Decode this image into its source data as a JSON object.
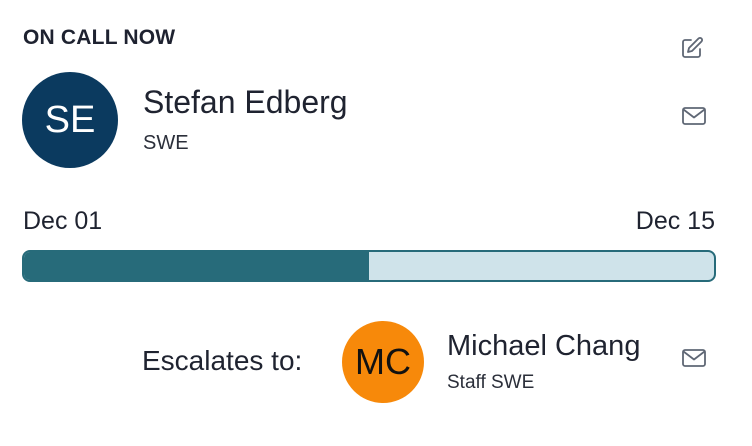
{
  "header": {
    "title": "ON CALL NOW"
  },
  "primary": {
    "initials": "SE",
    "name": "Stefan Edberg",
    "title": "SWE",
    "avatar_color": "#0b3a5f"
  },
  "schedule": {
    "start": "Dec 01",
    "end": "Dec 15",
    "progress": 0.5,
    "fill_color": "#276b7a",
    "track_color": "#cfe3ea"
  },
  "escalation": {
    "label": "Escalates to:",
    "initials": "MC",
    "name": "Michael Chang",
    "title": "Staff SWE",
    "avatar_color": "#f7890a"
  },
  "icons": {
    "edit": "edit-icon",
    "mail": "mail-icon"
  }
}
